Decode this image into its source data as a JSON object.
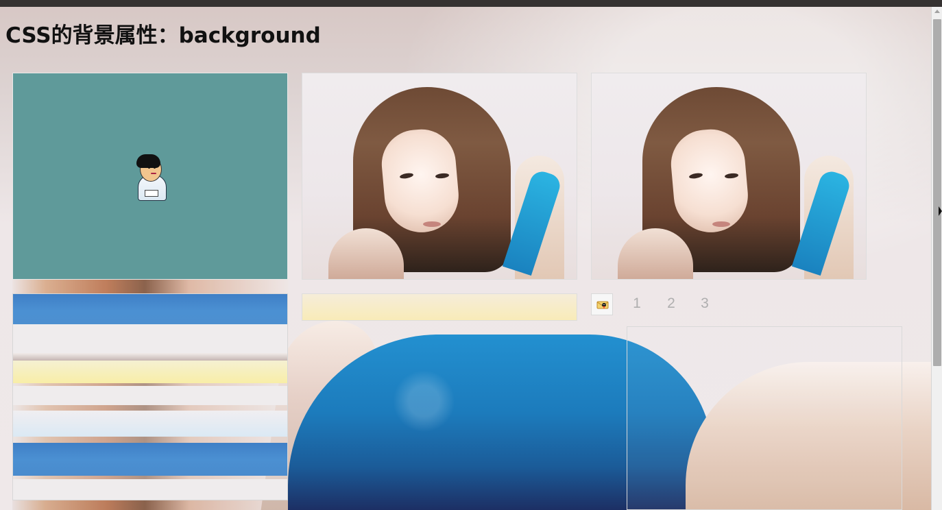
{
  "page": {
    "title": "CSS的背景属性：background"
  },
  "pagination": {
    "items": [
      "1",
      "2",
      "3"
    ]
  }
}
